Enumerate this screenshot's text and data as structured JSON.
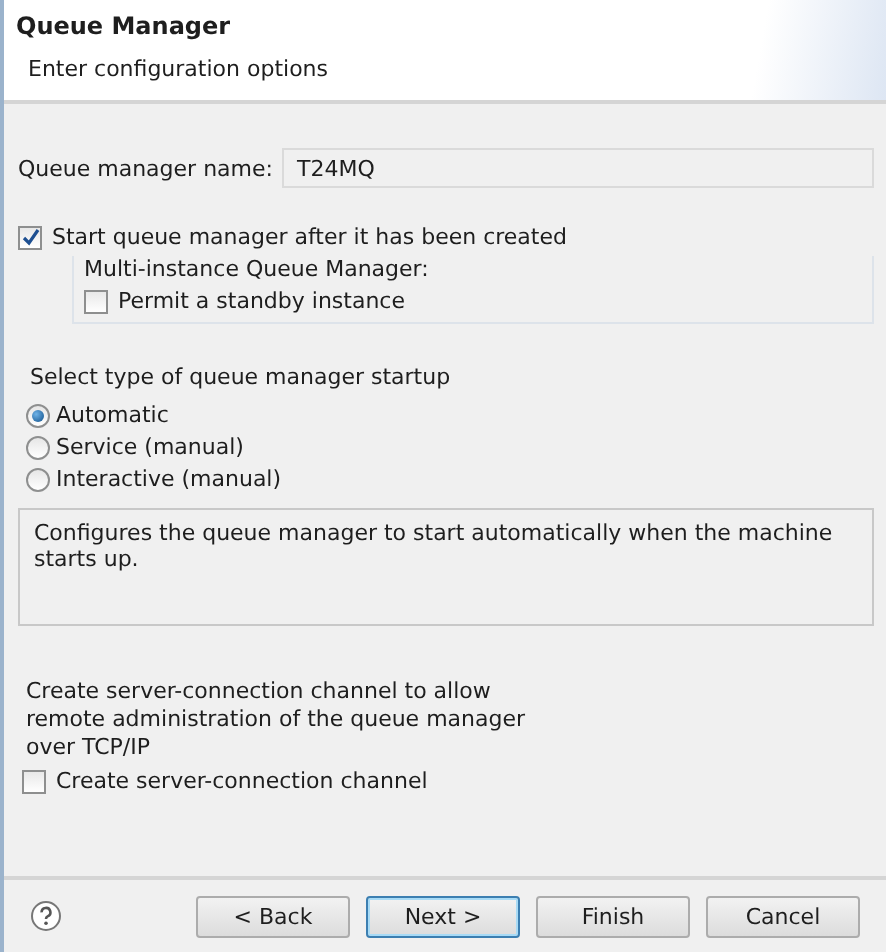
{
  "header": {
    "title": "Queue Manager",
    "subtitle": "Enter configuration options"
  },
  "name_field": {
    "label": "Queue manager name:",
    "value": "T24MQ"
  },
  "start_after_create": {
    "label": "Start queue manager after it has been created",
    "checked": true
  },
  "multi_instance": {
    "title": "Multi-instance Queue Manager:",
    "option": {
      "label": "Permit a standby instance",
      "checked": false
    }
  },
  "startup": {
    "label": "Select type of queue manager startup",
    "options": [
      {
        "label": "Automatic",
        "selected": true
      },
      {
        "label": "Service (manual)",
        "selected": false
      },
      {
        "label": "Interactive (manual)",
        "selected": false
      }
    ],
    "description": "Configures the queue manager to start automatically when the machine starts up."
  },
  "channel": {
    "text": "Create server-connection channel to allow remote administration of the queue manager over TCP/IP",
    "option": {
      "label": "Create server-connection channel",
      "checked": false
    }
  },
  "buttons": [
    {
      "label": "< Back",
      "default": false
    },
    {
      "label": "Next >",
      "default": true
    },
    {
      "label": "Finish",
      "default": false
    },
    {
      "label": "Cancel",
      "default": false
    }
  ]
}
